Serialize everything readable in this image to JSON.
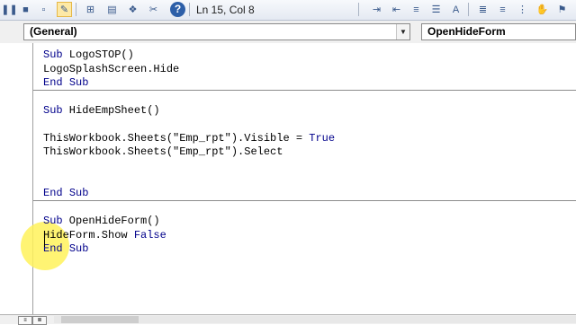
{
  "toolbar": {
    "status": "Ln 15, Col 8",
    "help_glyph": "?",
    "icons_left": [
      "pause-icon",
      "stop-icon",
      "design-mode-icon",
      "project-explorer-icon",
      "properties-icon",
      "object-browser-icon",
      "toolbox-icon"
    ],
    "icons_right": [
      "indent-icon",
      "outdent-icon",
      "list-members-icon",
      "list-constants-icon",
      "quick-info-icon",
      "parameter-info-icon",
      "complete-word-icon",
      "toggle-breakpoint-icon",
      "comment-block-icon",
      "uncomment-block-icon",
      "bookmark-icon"
    ]
  },
  "combos": {
    "object": "(General)",
    "procedure": "OpenHideForm"
  },
  "code": {
    "block1": {
      "l1_kw": "Sub",
      "l1_rest": " LogoSTOP()",
      "l2": "LogoSplashScreen.Hide",
      "l3_kw1": "End",
      "l3_kw2": "Sub"
    },
    "block2": {
      "l1_kw": "Sub",
      "l1_rest": " HideEmpSheet()",
      "l2_a": "ThisWorkbook.Sheets(\"Emp_rpt\").Visible = ",
      "l2_kw": "True",
      "l3": "ThisWorkbook.Sheets(\"Emp_rpt\").Select",
      "l4_kw1": "End",
      "l4_kw2": "Sub"
    },
    "block3": {
      "l1_kw": "Sub",
      "l1_rest": " OpenHideForm()",
      "l2_a": "HideForm.Show ",
      "l2_kw": "False",
      "l3_kw1": "End",
      "l3_kw2": "Sub"
    }
  },
  "colors": {
    "keyword": "#00008b",
    "cursor_highlight": "#fff25a"
  }
}
